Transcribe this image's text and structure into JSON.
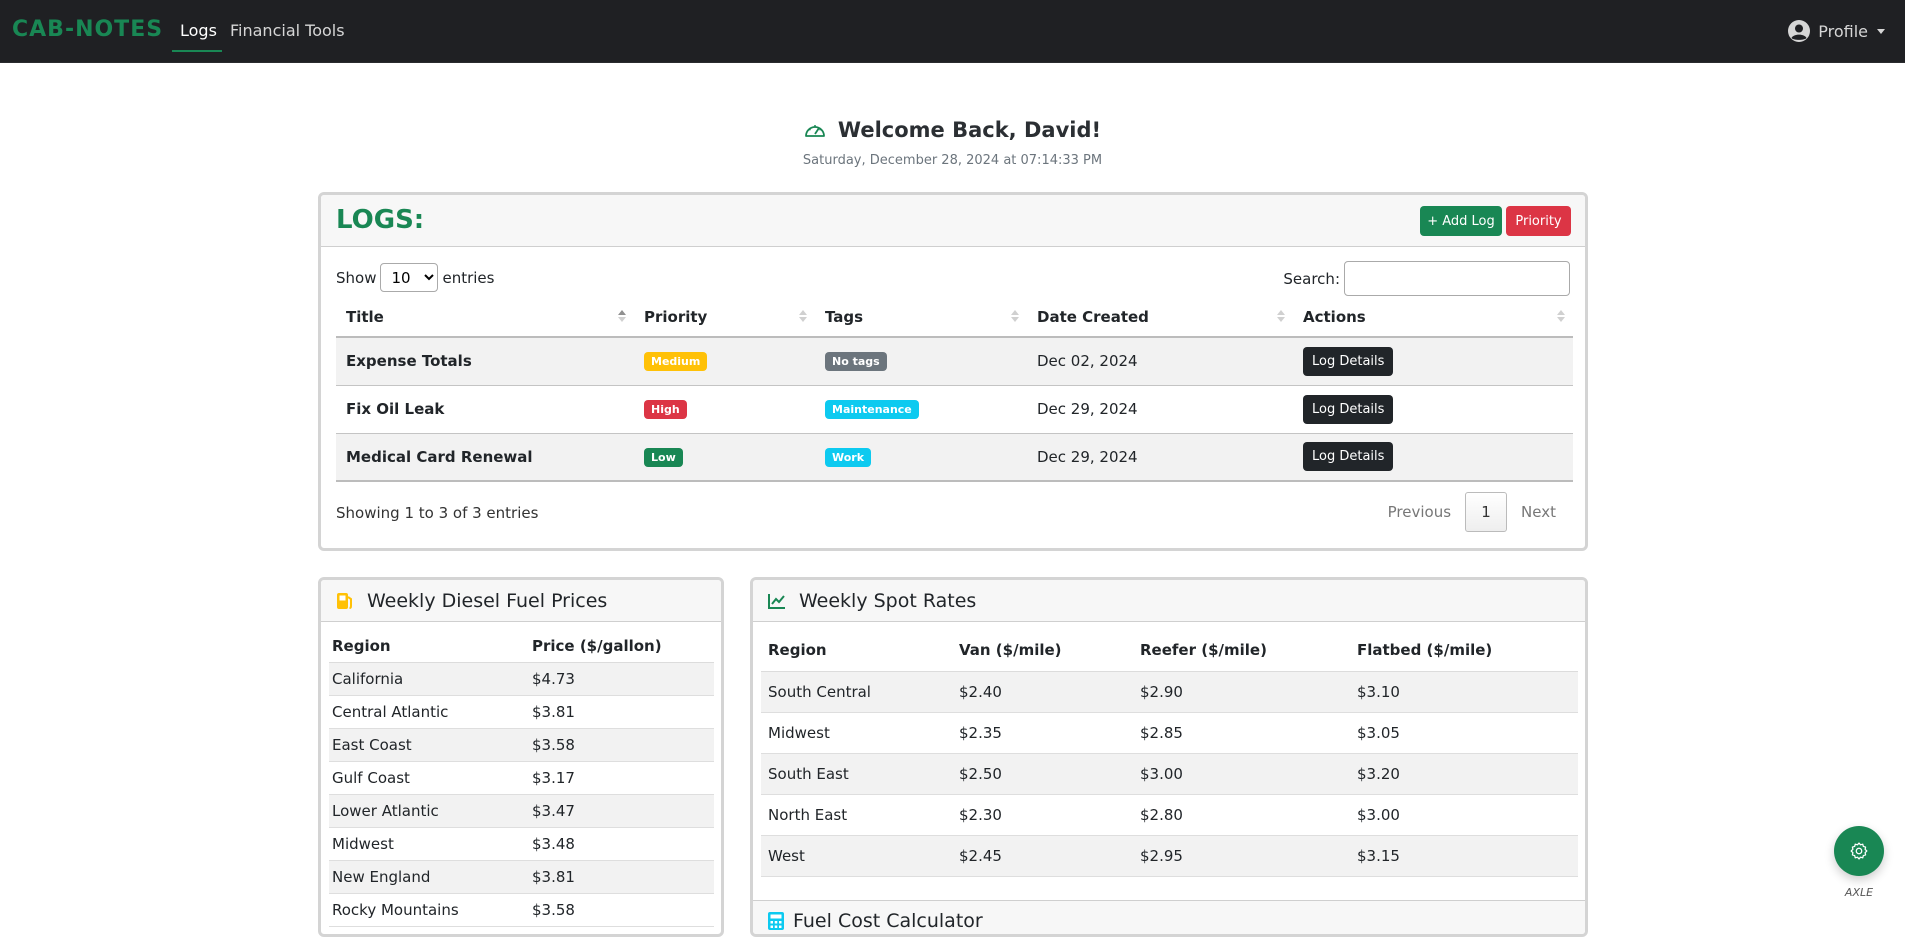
{
  "navbar": {
    "brand": "CAB-NOTES",
    "links": [
      {
        "label": "Logs",
        "active": true
      },
      {
        "label": "Financial Tools",
        "active": false
      }
    ],
    "profile_label": "Profile"
  },
  "welcome": {
    "title": "Welcome Back, David!",
    "date": "Saturday, December 28, 2024 at 07:14:33 PM",
    "icon": "speedometer-icon"
  },
  "logs": {
    "title": "LOGS:",
    "add_button": "+ Add Log",
    "priority_button": "Priority",
    "show_label": "Show",
    "entries_label": "entries",
    "page_length": "10",
    "search_label": "Search:",
    "search_value": "",
    "columns": [
      "Title",
      "Priority",
      "Tags",
      "Date Created",
      "Actions"
    ],
    "rows": [
      {
        "title": "Expense Totals",
        "priority": "Medium",
        "priority_color": "#ffc107",
        "tag": "No tags",
        "tag_color": "#6c757d",
        "date": "Dec 02, 2024",
        "action": "Log Details"
      },
      {
        "title": "Fix Oil Leak",
        "priority": "High",
        "priority_color": "#dc3545",
        "tag": "Maintenance",
        "tag_color": "#0dcaf0",
        "date": "Dec 29, 2024",
        "action": "Log Details"
      },
      {
        "title": "Medical Card Renewal",
        "priority": "Low",
        "priority_color": "#198754",
        "tag": "Work",
        "tag_color": "#0dcaf0",
        "date": "Dec 29, 2024",
        "action": "Log Details"
      }
    ],
    "info": "Showing 1 to 3 of 3 entries",
    "pagination": {
      "previous": "Previous",
      "current": "1",
      "next": "Next"
    }
  },
  "fuel": {
    "title": "Weekly Diesel Fuel Prices",
    "icon": "gas-pump-icon",
    "columns": [
      "Region",
      "Price ($/gallon)"
    ],
    "rows": [
      [
        "California",
        "$4.73"
      ],
      [
        "Central Atlantic",
        "$3.81"
      ],
      [
        "East Coast",
        "$3.58"
      ],
      [
        "Gulf Coast",
        "$3.17"
      ],
      [
        "Lower Atlantic",
        "$3.47"
      ],
      [
        "Midwest",
        "$3.48"
      ],
      [
        "New England",
        "$3.81"
      ],
      [
        "Rocky Mountains",
        "$3.58"
      ]
    ]
  },
  "spot": {
    "title": "Weekly Spot Rates",
    "icon": "chart-line-icon",
    "columns": [
      "Region",
      "Van ($/mile)",
      "Reefer ($/mile)",
      "Flatbed ($/mile)"
    ],
    "rows": [
      [
        "South Central",
        "$2.40",
        "$2.90",
        "$3.10"
      ],
      [
        "Midwest",
        "$2.35",
        "$2.85",
        "$3.05"
      ],
      [
        "South East",
        "$2.50",
        "$3.00",
        "$3.20"
      ],
      [
        "North East",
        "$2.30",
        "$2.80",
        "$3.00"
      ],
      [
        "West",
        "$2.45",
        "$2.95",
        "$3.15"
      ]
    ]
  },
  "calculator": {
    "title": "Fuel Cost Calculator",
    "icon": "calculator-icon"
  },
  "assistant": {
    "label": "AXLE",
    "icon": "gear-icon"
  },
  "colors": {
    "brand": "#198754",
    "danger": "#dc3545",
    "navbar": "#1f2023"
  }
}
